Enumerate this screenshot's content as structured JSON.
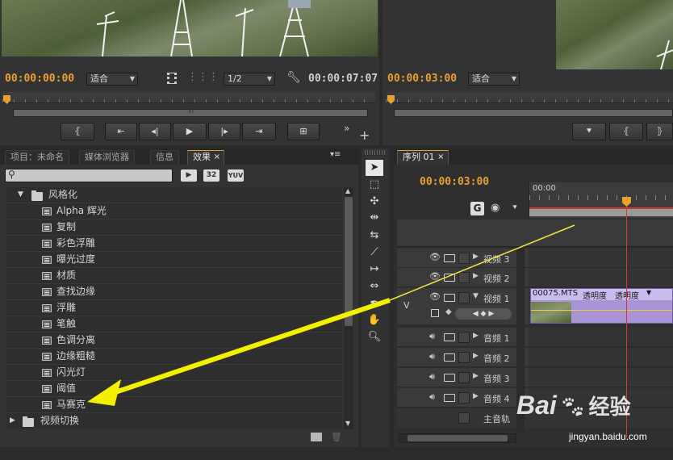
{
  "source_monitor": {
    "timecode_current": "00:00:00:00",
    "fit_label": "适合",
    "resolution": "1/2",
    "timecode_duration": "00:00:07:07"
  },
  "program_monitor": {
    "timecode_current": "00:00:03:00",
    "fit_label": "适合"
  },
  "project_panel": {
    "tabs": [
      {
        "label": "项目：未命名"
      },
      {
        "label": "媒体浏览器"
      },
      {
        "label": "信息"
      },
      {
        "label": "效果"
      }
    ],
    "search_value": "",
    "accel_badges": [
      "32",
      "YUV"
    ],
    "group_name": "风格化",
    "effects": [
      "Alpha 辉光",
      "复制",
      "彩色浮雕",
      "曝光过度",
      "材质",
      "查找边缘",
      "浮雕",
      "笔触",
      "色调分离",
      "边缘粗糙",
      "闪光灯",
      "阈值",
      "马赛克"
    ],
    "next_group": "视频切换"
  },
  "timeline": {
    "tab_label": "序列 01",
    "timecode": "00:00:03:00",
    "ruler_start": "00:00",
    "clip": {
      "name": "00075.MTS",
      "fx1": "透明度",
      "fx2": "透明度"
    },
    "target_label": "V",
    "video_tracks": [
      "视频 3",
      "视频 2",
      "视频 1"
    ],
    "audio_tracks": [
      "音频 1",
      "音频 2",
      "音频 3",
      "音频 4"
    ],
    "master_track": "主音轨"
  },
  "watermark": {
    "brand": "Bai",
    "brand2": "经验",
    "url": "jingyan.baidu.com"
  }
}
